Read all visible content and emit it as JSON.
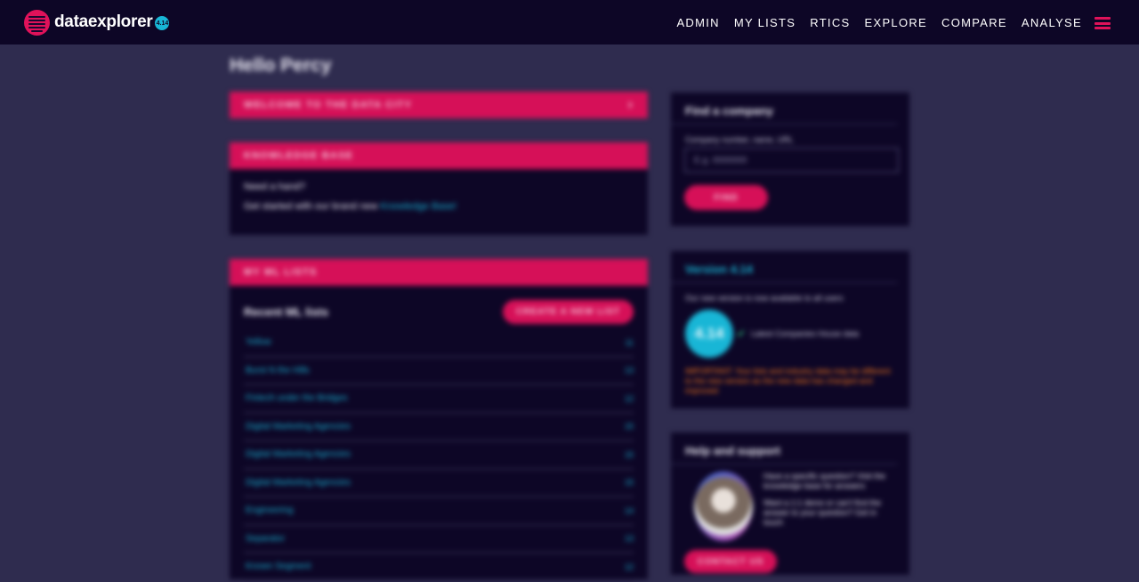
{
  "nav": {
    "brand": "dataexplorer",
    "version_badge": "4.14",
    "links": [
      "ADMIN",
      "MY LISTS",
      "RTICS",
      "EXPLORE",
      "COMPARE",
      "ANALYSE"
    ],
    "menu_icon": "hamburger-icon"
  },
  "greeting": "Hello Percy",
  "welcome": {
    "label": "WELCOME TO THE DATA CITY",
    "icon": "chevron-right-icon"
  },
  "knowledge": {
    "title": "KNOWLEDGE BASE",
    "line1": "Need a hand?",
    "line2_prefix": "Get started with our brand new ",
    "line2_link": "Knowledge Base!"
  },
  "ml_lists": {
    "title": "MY ML LISTS",
    "subtitle": "Recent ML lists",
    "create_label": "CREATE A NEW LIST",
    "rows": [
      {
        "name": "Yellow",
        "count": "11"
      },
      {
        "name": "Burst N the Hills",
        "count": "13"
      },
      {
        "name": "Fintech under the Bridges",
        "count": "12"
      },
      {
        "name": "Digital Marketing Agencies",
        "count": "15"
      },
      {
        "name": "Digital Marketing Agencies",
        "count": "15"
      },
      {
        "name": "Digital Marketing Agencies",
        "count": "15"
      },
      {
        "name": "Engineering",
        "count": "14"
      },
      {
        "name": "Separator",
        "count": "13"
      },
      {
        "name": "Known Segment",
        "count": "12"
      }
    ]
  },
  "find_company": {
    "title": "Find a company",
    "field_label": "Company number, name, URL",
    "placeholder": "E.g. 0000000",
    "button": "FIND"
  },
  "version_panel": {
    "title": "Version 4.14",
    "note": "Our new version is now available to all users",
    "badge": "4.14",
    "item": "Latest Companies House data",
    "warning": "IMPORTANT: Your lists and industry data may be different to the new version as the new data has changed and improved"
  },
  "help": {
    "title": "Help and support",
    "text1": "Have a specific question? Visit the knowledge base for answers",
    "text2": "Want a 1:1 demo or can't find the answer to your question? Get in touch",
    "button": "CONTACT US"
  }
}
